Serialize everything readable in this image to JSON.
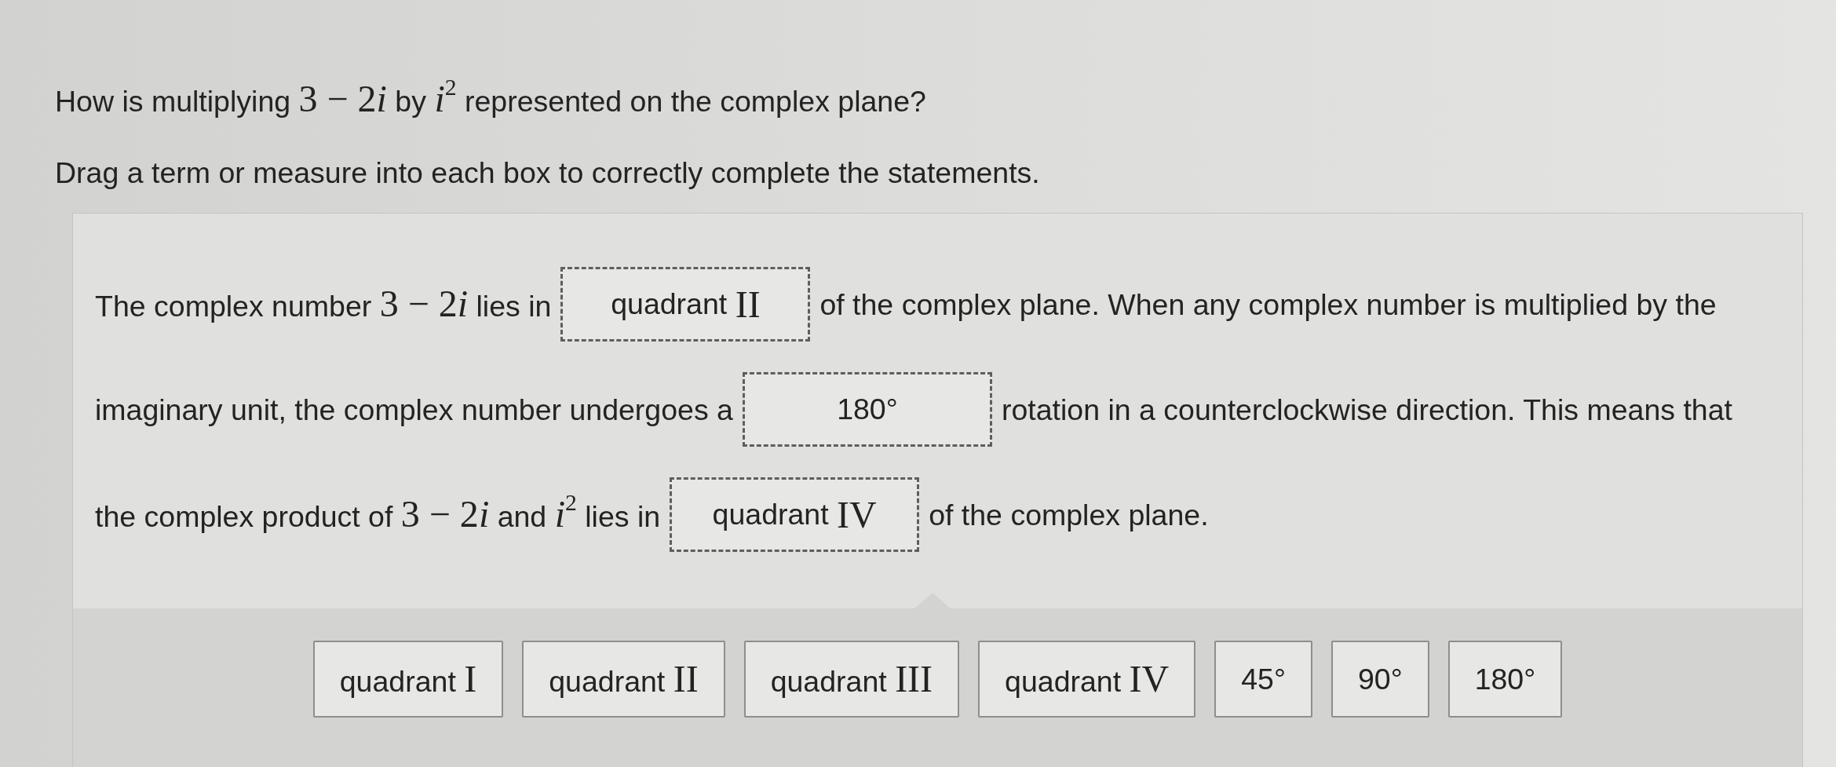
{
  "question": [
    {
      "kind": "text",
      "text": "How is multiplying "
    },
    {
      "kind": "math",
      "text": "3 − 2"
    },
    {
      "kind": "var",
      "text": "i"
    },
    {
      "kind": "text",
      "text": " by "
    },
    {
      "kind": "var",
      "text": "i$^{2}$"
    },
    {
      "kind": "text",
      "text": " represented on the complex plane?"
    }
  ],
  "instructions": "Drag a term or measure into each box to correctly complete the statements.",
  "statement_lines": [
    [
      {
        "kind": "text",
        "parts": [
          {
            "kind": "text",
            "text": "The complex number "
          },
          {
            "kind": "math",
            "text": "3 − 2"
          },
          {
            "kind": "var",
            "text": "i"
          },
          {
            "kind": "text",
            "text": " lies in"
          }
        ]
      },
      {
        "kind": "drop",
        "value": {
          "text": "quadrant",
          "math": "II"
        }
      },
      {
        "kind": "text",
        "parts": [
          {
            "kind": "text",
            "text": "of the complex plane. When any complex number is multiplied by the"
          }
        ]
      }
    ],
    [
      {
        "kind": "text",
        "parts": [
          {
            "kind": "text",
            "text": "imaginary unit, the complex number undergoes a"
          }
        ]
      },
      {
        "kind": "drop",
        "value": {
          "text": "180°"
        }
      },
      {
        "kind": "text",
        "parts": [
          {
            "kind": "text",
            "text": "rotation in a counterclockwise direction. This means that"
          }
        ]
      }
    ],
    [
      {
        "kind": "text",
        "parts": [
          {
            "kind": "text",
            "text": "the complex product of "
          },
          {
            "kind": "math",
            "text": "3 − 2"
          },
          {
            "kind": "var",
            "text": "i"
          },
          {
            "kind": "text",
            "text": " and "
          },
          {
            "kind": "var",
            "text": "i$^{2}$"
          },
          {
            "kind": "text",
            "text": " lies in"
          }
        ]
      },
      {
        "kind": "drop",
        "value": {
          "text": "quadrant",
          "math": "IV"
        }
      },
      {
        "kind": "text",
        "parts": [
          {
            "kind": "text",
            "text": "of the complex plane."
          }
        ]
      }
    ]
  ],
  "answer_bank": [
    {
      "text": "quadrant",
      "math": "I"
    },
    {
      "text": "quadrant",
      "math": "II"
    },
    {
      "text": "quadrant",
      "math": "III"
    },
    {
      "text": "quadrant",
      "math": "IV"
    },
    {
      "text": "45°"
    },
    {
      "text": "90°"
    },
    {
      "text": "180°"
    }
  ]
}
